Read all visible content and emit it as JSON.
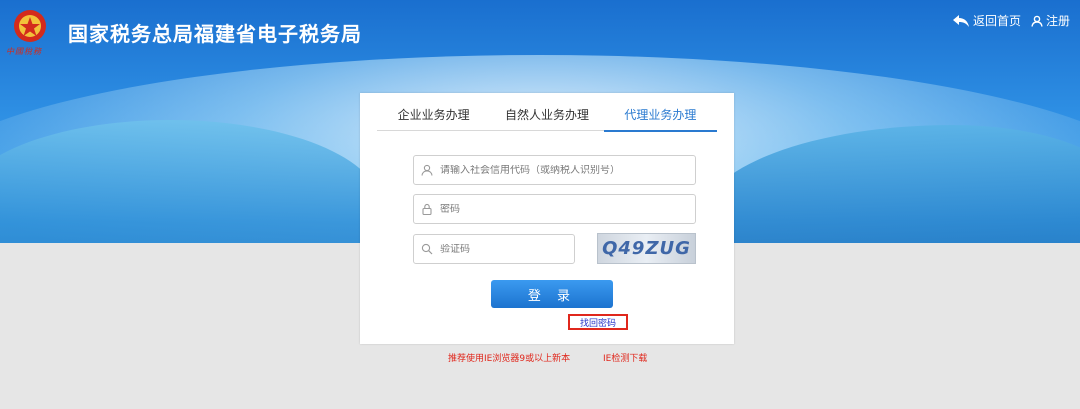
{
  "header": {
    "emblem_caption": "中國稅務",
    "site_title": "国家税务总局福建省电子税务局",
    "back_home": "返回首页",
    "register": "注册"
  },
  "login": {
    "tabs": [
      {
        "label": "企业业务办理",
        "active": false
      },
      {
        "label": "自然人业务办理",
        "active": false
      },
      {
        "label": "代理业务办理",
        "active": true
      }
    ],
    "credit_code_placeholder": "请输入社会信用代码（或纳税人识别号）",
    "password_placeholder": "密码",
    "captcha_placeholder": "验证码",
    "captcha_text": "Q49ZUG",
    "login_button": "登 录",
    "forgot_password": "找回密码"
  },
  "footer": {
    "browser_note": "推荐使用IE浏览器9或以上新本",
    "ie_check": "IE检测下载"
  },
  "colors": {
    "accent": "#2a7ad0",
    "button": "#1c73cf",
    "warning": "#e0271c",
    "banner_top": "#1a6fcf"
  }
}
